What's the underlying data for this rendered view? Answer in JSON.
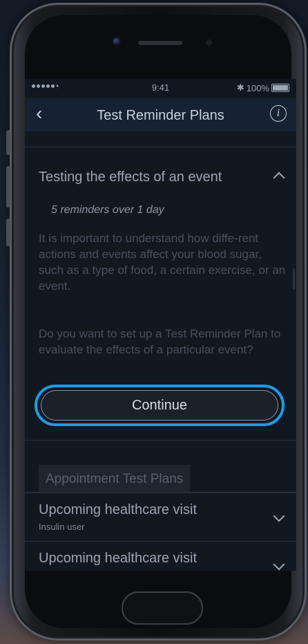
{
  "status_bar": {
    "time": "9:41",
    "battery": "100%"
  },
  "nav": {
    "title": "Test Reminder Plans"
  },
  "section": {
    "title": "Testing the effects of an event",
    "subtitle": "5 reminders over 1 day",
    "description": "It is important to understand how diffe-rent actions and events affect your blood sugar, such as a type of food, a certain exercise, or an event.",
    "question": "Do you want to set up a Test Reminder Plan to evaluate the effects of a particular event?",
    "continue_label": "Continue"
  },
  "appointment": {
    "header": "Appointment Test Plans",
    "items": [
      {
        "title": "Upcoming healthcare visit",
        "subtitle": "Insulin user"
      },
      {
        "title": "Upcoming healthcare visit",
        "subtitle": ""
      }
    ]
  }
}
